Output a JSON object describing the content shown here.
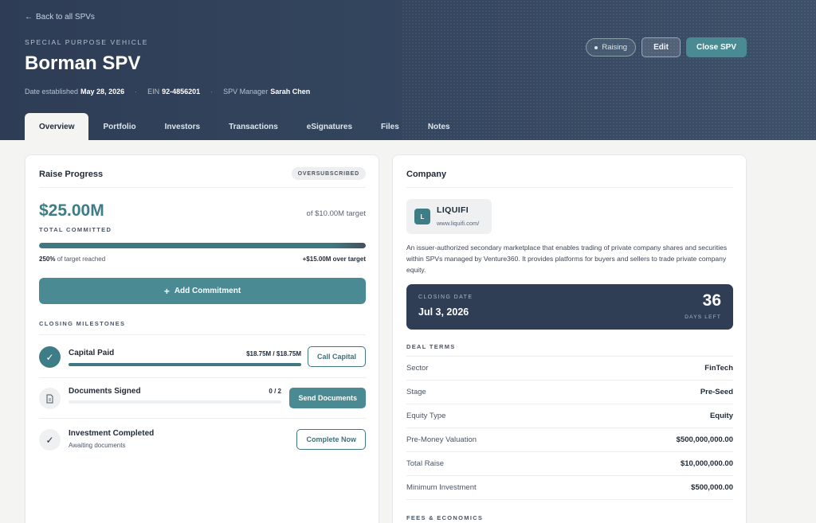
{
  "header": {
    "back_link": "Back to all SPVs",
    "eyebrow": "SPECIAL PURPOSE VEHICLE",
    "title": "Borman SPV",
    "meta": {
      "date_label": "Date established",
      "date_value": "May 28, 2026",
      "ein_label": "EIN",
      "ein_value": "92-4856201",
      "manager_label": "SPV Manager",
      "manager_value": "Sarah Chen"
    },
    "status_pill": "Raising",
    "edit_label": "Edit",
    "close_label": "Close SPV",
    "tabs": [
      "Overview",
      "Portfolio",
      "Investors",
      "Transactions",
      "eSignatures",
      "Files",
      "Notes"
    ],
    "active_tab": "Overview"
  },
  "raise": {
    "title": "Raise Progress",
    "badge": "OVERSUBSCRIBED",
    "amount": "$25.00M",
    "of_target": "of $10.00M target",
    "total_label": "TOTAL COMMITTED",
    "progress_fraction": 1.0,
    "pct_value": "250%",
    "pct_text": "of target reached",
    "over_target": "+$15.00M over target",
    "add_button": "Add Commitment",
    "milestones_label": "CLOSING MILESTONES",
    "milestones": [
      {
        "title": "Capital Paid",
        "amount": "$18.75M / $18.75M",
        "progress": 1.0,
        "action": "Call Capital",
        "state": "done"
      },
      {
        "title": "Documents Signed",
        "amount": "0 / 2",
        "progress": 0.0,
        "action": "Send Documents",
        "state": "pending"
      },
      {
        "title": "Investment Completed",
        "subtitle": "Awaiting documents",
        "action": "Complete Now",
        "state": "check"
      }
    ]
  },
  "company": {
    "title": "Company",
    "logo_letter": "L",
    "name": "LIQUIFI",
    "url": "www.liquifi.com/",
    "description": "An issuer-authorized secondary marketplace that enables trading of private company shares and securities within SPVs managed by Venture360. It provides platforms for buyers and sellers to trade private company equity.",
    "closing_label": "CLOSING DATE",
    "closing_date": "Jul 3, 2026",
    "days_left": "36",
    "days_left_label": "DAYS LEFT",
    "deal_terms_label": "DEAL TERMS",
    "deal_terms": [
      {
        "k": "Sector",
        "v": "FinTech"
      },
      {
        "k": "Stage",
        "v": "Pre-Seed"
      },
      {
        "k": "Equity Type",
        "v": "Equity"
      },
      {
        "k": "Pre-Money Valuation",
        "v": "$500,000,000.00"
      },
      {
        "k": "Total Raise",
        "v": "$10,000,000.00"
      },
      {
        "k": "Minimum Investment",
        "v": "$500,000.00"
      }
    ],
    "fees_label": "FEES & ECONOMICS"
  },
  "colors": {
    "accent": "#4a8a93",
    "header": "#2e3d55",
    "dark_card": "#2f3e55"
  },
  "icons": {
    "back": "arrow-left-icon",
    "add": "plus-icon",
    "done": "check-icon",
    "doc": "document-icon"
  }
}
